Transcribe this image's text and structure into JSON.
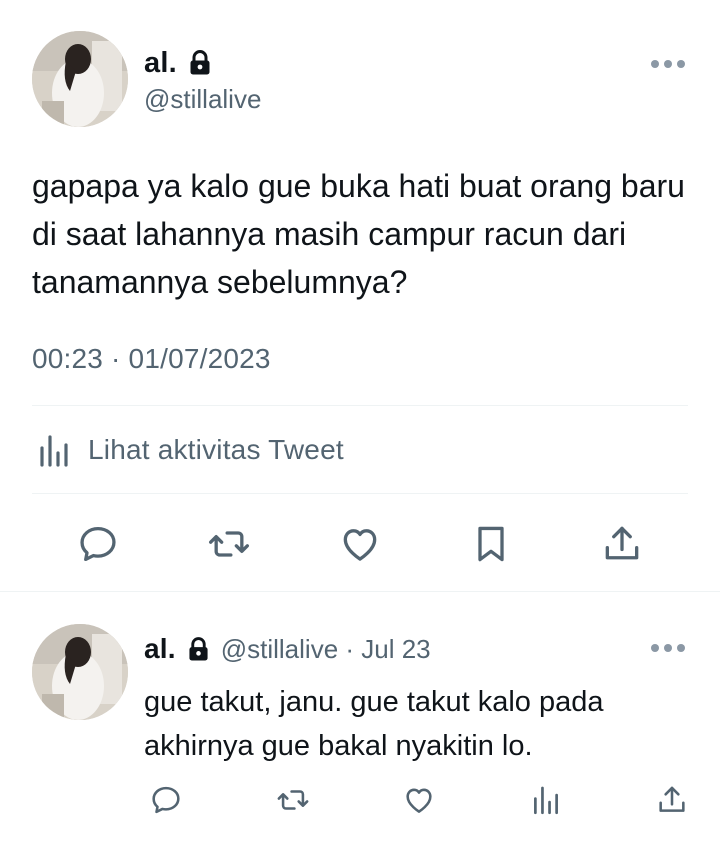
{
  "tweet": {
    "display_name": "al.",
    "handle": "@stillalive",
    "text": "gapapa ya kalo gue buka hati buat orang baru di saat lahannya masih campur racun dari tanamannya sebelumnya?",
    "timestamp": "00:23 · 01/07/2023",
    "activity_label": "Lihat aktivitas Tweet",
    "actions": [
      "reply-icon",
      "retweet-icon",
      "like-icon",
      "bookmark-icon",
      "share-icon"
    ]
  },
  "reply": {
    "display_name": "al.",
    "meta": "@stillalive · Jul 23",
    "text": "gue takut, janu. gue takut kalo pada akhirnya gue bakal nyakitin lo.",
    "actions": [
      "reply-icon",
      "retweet-icon",
      "like-icon",
      "views-icon",
      "share-icon"
    ]
  },
  "colors": {
    "text": "#0f1419",
    "secondary": "#536471",
    "divider": "#eff3f4",
    "icon": "#536471"
  }
}
